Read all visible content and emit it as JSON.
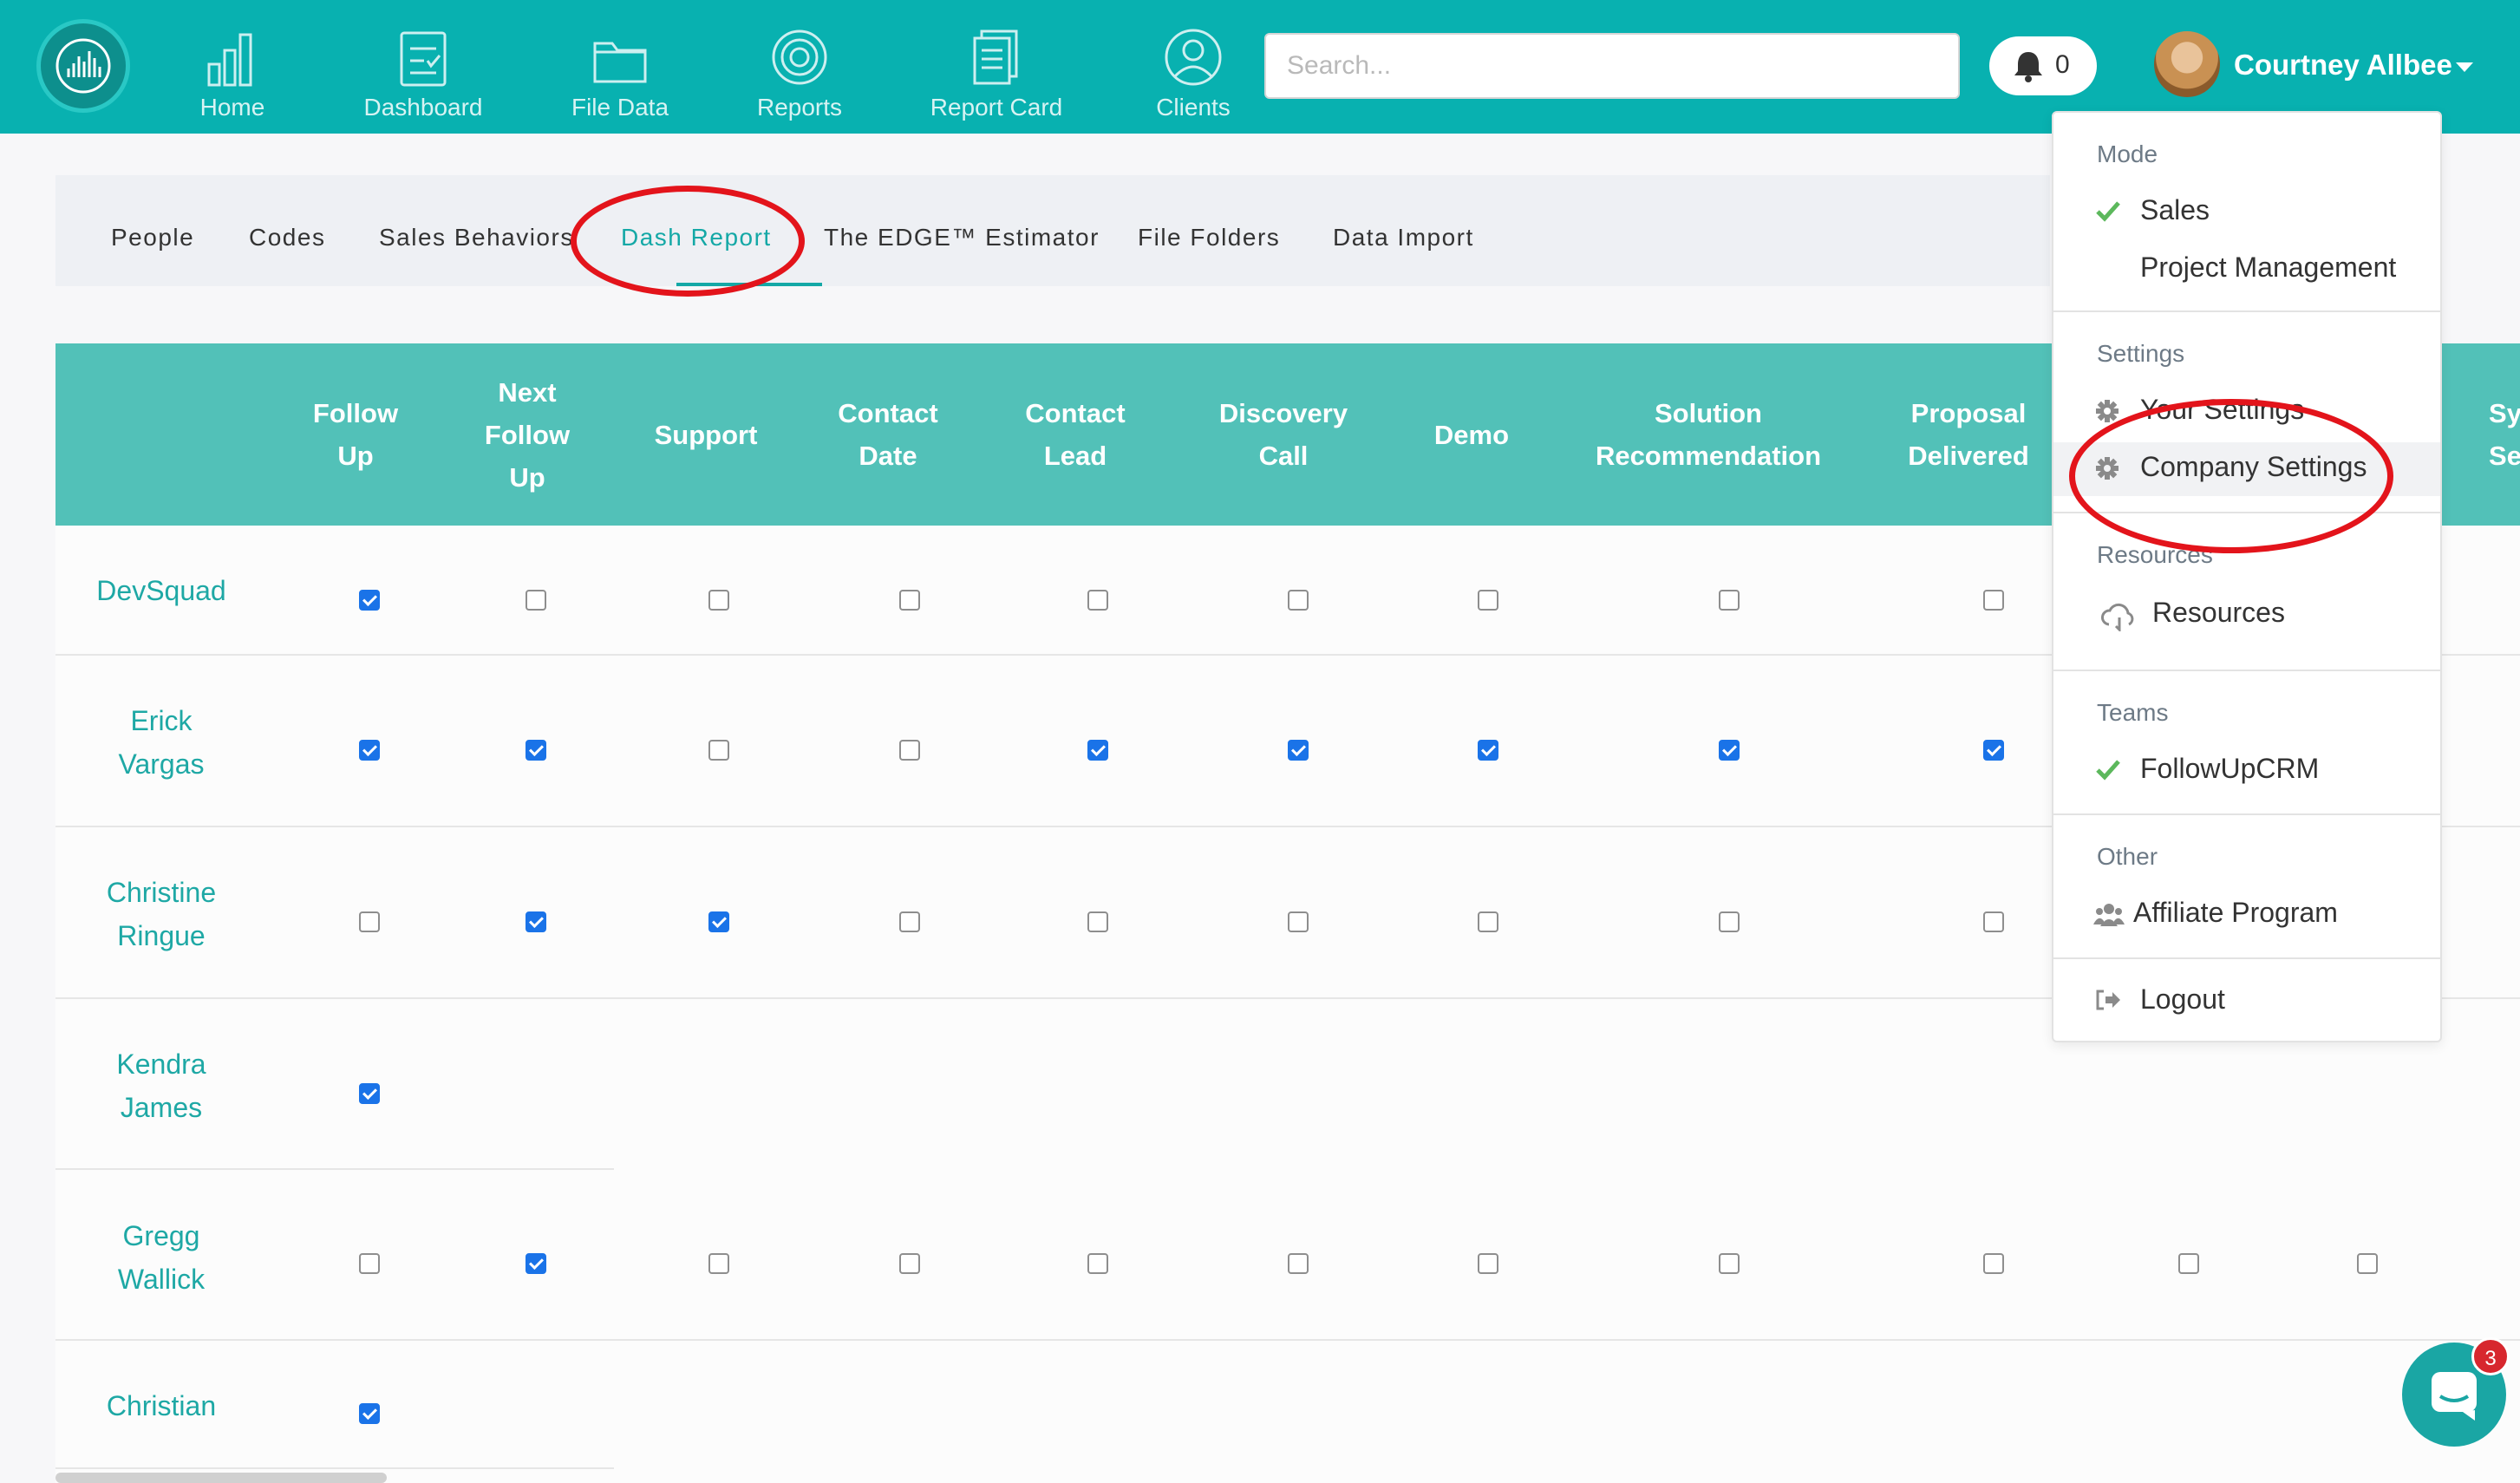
{
  "nav": {
    "items": [
      {
        "label": "Home",
        "icon": "bar-chart-icon"
      },
      {
        "label": "Dashboard",
        "icon": "clipboard-icon"
      },
      {
        "label": "File Data",
        "icon": "folder-icon"
      },
      {
        "label": "Reports",
        "icon": "target-icon"
      },
      {
        "label": "Report Card",
        "icon": "document-icon"
      },
      {
        "label": "Clients",
        "icon": "user-icon"
      }
    ],
    "search_placeholder": "Search...",
    "notifications_count": "0",
    "user_name": "Courtney Allbee"
  },
  "tabs": [
    "People",
    "Codes",
    "Sales Behaviors",
    "Dash Report",
    "The EDGE™ Estimator",
    "File Folders",
    "Data Import"
  ],
  "active_tab": "Dash Report",
  "table": {
    "columns": [
      "Follow Up",
      "Next Follow Up",
      "Support",
      "Contact Date",
      "Contact Lead",
      "Discovery Call",
      "Demo",
      "Solution Recommendation",
      "Proposal Delivered",
      "Sy Se"
    ],
    "rows": [
      {
        "name": "DevSquad",
        "checks": [
          true,
          false,
          false,
          false,
          false,
          false,
          false,
          false,
          false
        ]
      },
      {
        "name": "Erick Vargas",
        "checks": [
          true,
          true,
          false,
          false,
          true,
          true,
          true,
          true,
          true
        ]
      },
      {
        "name": "Christine Ringue",
        "checks": [
          false,
          true,
          true,
          false,
          false,
          false,
          false,
          false,
          false
        ]
      },
      {
        "name": "Kendra James",
        "checks": [
          true
        ]
      },
      {
        "name": "Gregg Wallick",
        "checks": [
          false,
          true,
          false,
          false,
          false,
          false,
          false,
          false,
          false,
          false,
          false
        ]
      },
      {
        "name": "Christian",
        "checks": [
          true
        ]
      }
    ]
  },
  "dropdown": {
    "mode_header": "Mode",
    "mode_sales": "Sales",
    "mode_project": "Project Management",
    "settings_header": "Settings",
    "your_settings": "Your Settings",
    "company_settings": "Company Settings",
    "resources_header": "Resources",
    "resources": "Resources",
    "teams_header": "Teams",
    "team_followup": "FollowUpCRM",
    "other_header": "Other",
    "affiliate": "Affiliate Program",
    "logout": "Logout"
  },
  "chat": {
    "badge": "3"
  },
  "colors": {
    "brand": "#08b1b0",
    "header": "#52c1b8",
    "accent": "#14a8a6",
    "annotation": "#e3141b"
  }
}
